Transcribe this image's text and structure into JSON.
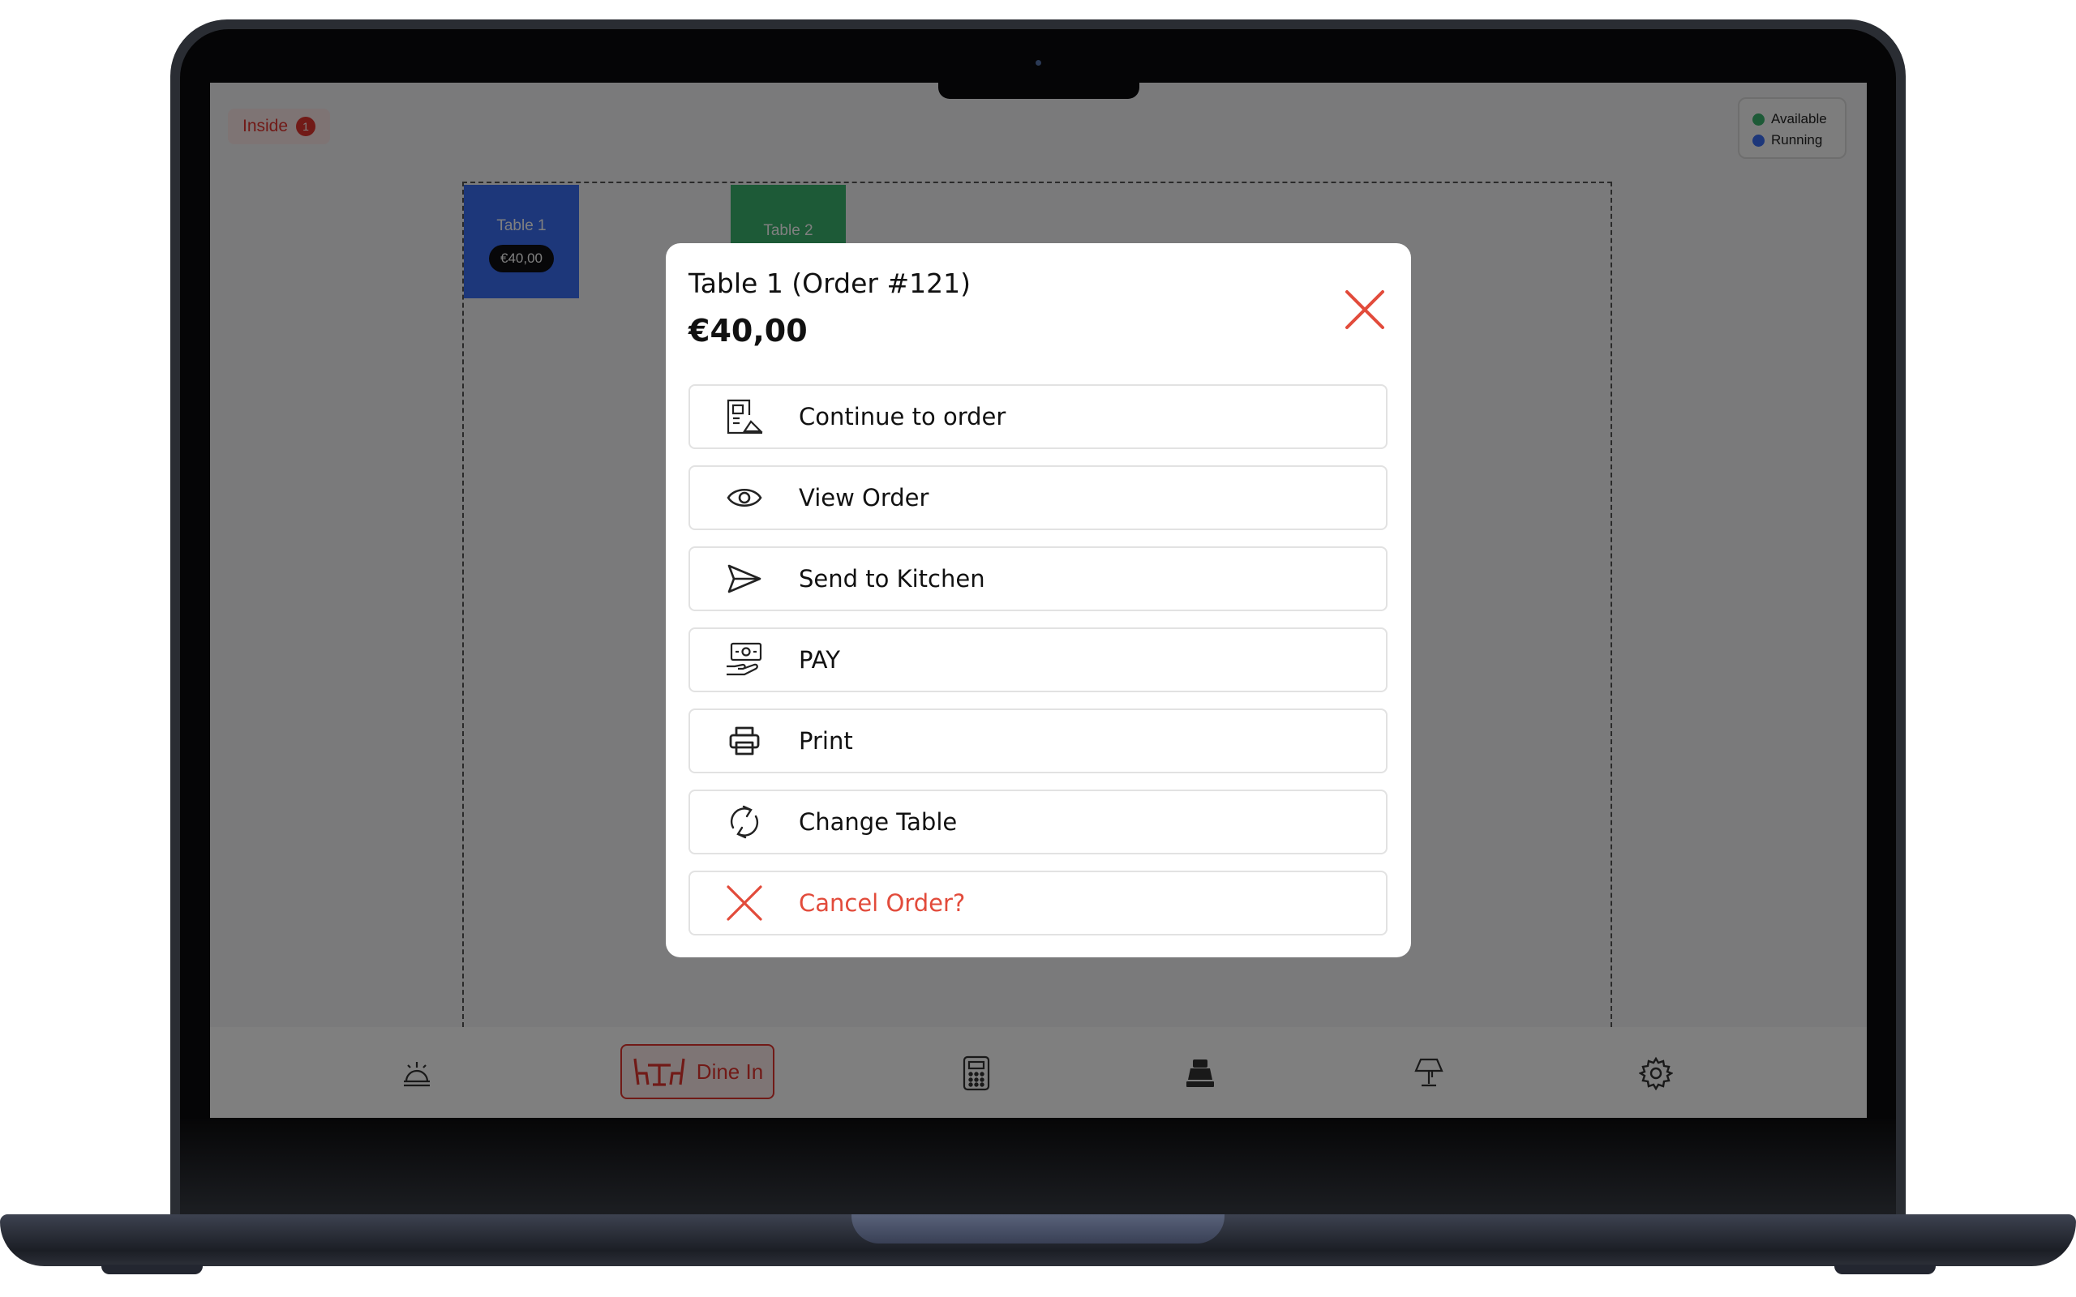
{
  "floor": {
    "area_tab": {
      "label": "Inside",
      "count": "1"
    },
    "legend": [
      {
        "label": "Available",
        "color": "#3bb56f"
      },
      {
        "label": "Running",
        "color": "#3b6ef5"
      }
    ],
    "tables": [
      {
        "name": "Table 1",
        "amount": "€40,00",
        "status": "running"
      },
      {
        "name": "Table 2",
        "status": "available"
      }
    ]
  },
  "bottom_nav": {
    "items": [
      {
        "icon": "service-bell-icon"
      },
      {
        "icon": "dine-in-table-icon",
        "label": "Dine In",
        "active": true
      },
      {
        "icon": "calculator-icon"
      },
      {
        "icon": "cash-register-icon"
      },
      {
        "icon": "table-lamp-icon"
      },
      {
        "icon": "gear-icon"
      }
    ]
  },
  "modal": {
    "title": "Table 1 (Order #121)",
    "amount": "€40,00",
    "close_icon": "close-icon",
    "actions": [
      {
        "label": "Continue to order",
        "icon": "order-form-icon"
      },
      {
        "label": "View Order",
        "icon": "eye-icon"
      },
      {
        "label": "Send to Kitchen",
        "icon": "send-icon"
      },
      {
        "label": "PAY",
        "icon": "cash-hand-icon"
      },
      {
        "label": "Print",
        "icon": "printer-icon"
      },
      {
        "label": "Change Table",
        "icon": "refresh-icon"
      },
      {
        "label": "Cancel Order?",
        "icon": "close-icon",
        "danger": true
      }
    ]
  },
  "colors": {
    "accent": "#e3342f",
    "running": "#3b6ef5",
    "available": "#3bb56f",
    "danger_text": "#e24b3b"
  }
}
